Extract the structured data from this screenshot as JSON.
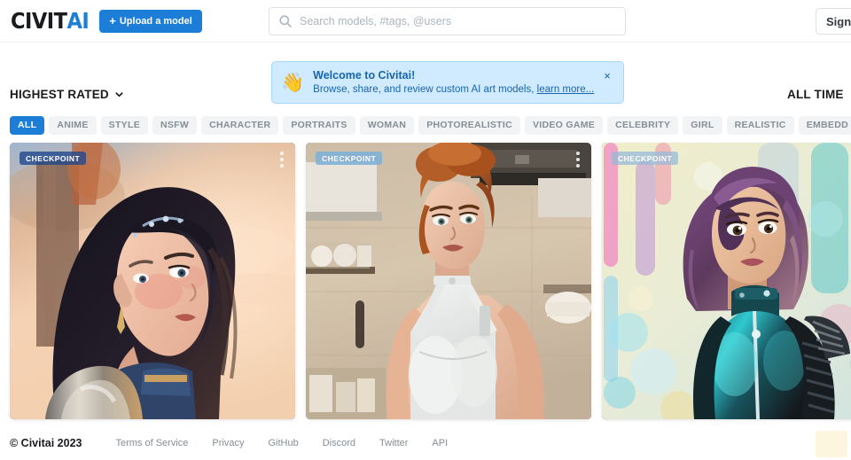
{
  "header": {
    "logo_dark": "CIVIT",
    "logo_blue": "AI",
    "upload_label": "Upload a model",
    "upload_plus": "+",
    "search_placeholder": "Search models, #tags, @users",
    "signin_label": "Sign In",
    "accent_color": "#1c7ed6"
  },
  "banner": {
    "emoji": "👋",
    "title": "Welcome to Civitai!",
    "subtitle": "Browse, share, and review custom AI art models,",
    "link_label": "learn more...",
    "close_label": "×",
    "bg_color": "#d0ebff",
    "text_color": "#1864ab"
  },
  "controls": {
    "sort_label": "HIGHEST RATED",
    "period_label": "ALL TIME"
  },
  "tags": [
    {
      "label": "ALL",
      "active": true
    },
    {
      "label": "ANIME",
      "active": false
    },
    {
      "label": "STYLE",
      "active": false
    },
    {
      "label": "NSFW",
      "active": false
    },
    {
      "label": "CHARACTER",
      "active": false
    },
    {
      "label": "PORTRAITS",
      "active": false
    },
    {
      "label": "WOMAN",
      "active": false
    },
    {
      "label": "PHOTOREALISTIC",
      "active": false
    },
    {
      "label": "VIDEO GAME",
      "active": false
    },
    {
      "label": "CELEBRITY",
      "active": false
    },
    {
      "label": "GIRL",
      "active": false
    },
    {
      "label": "REALISTIC",
      "active": false
    },
    {
      "label": "EMBEDD",
      "active": false
    }
  ],
  "cards": [
    {
      "badge": "CHECKPOINT",
      "alt": "fantasy warrior woman with dark hair and silver armor at sunset"
    },
    {
      "badge": "CHECKPOINT",
      "alt": "red haired woman in white apron standing in a kitchen"
    },
    {
      "badge": "CHECKPOINT",
      "alt": "cyberpunk woman with purple hair in teal jacket with neon lights"
    }
  ],
  "footer": {
    "copyright": "© Civitai 2023",
    "links": [
      "Terms of Service",
      "Privacy",
      "GitHub",
      "Discord",
      "Twitter",
      "API"
    ]
  }
}
